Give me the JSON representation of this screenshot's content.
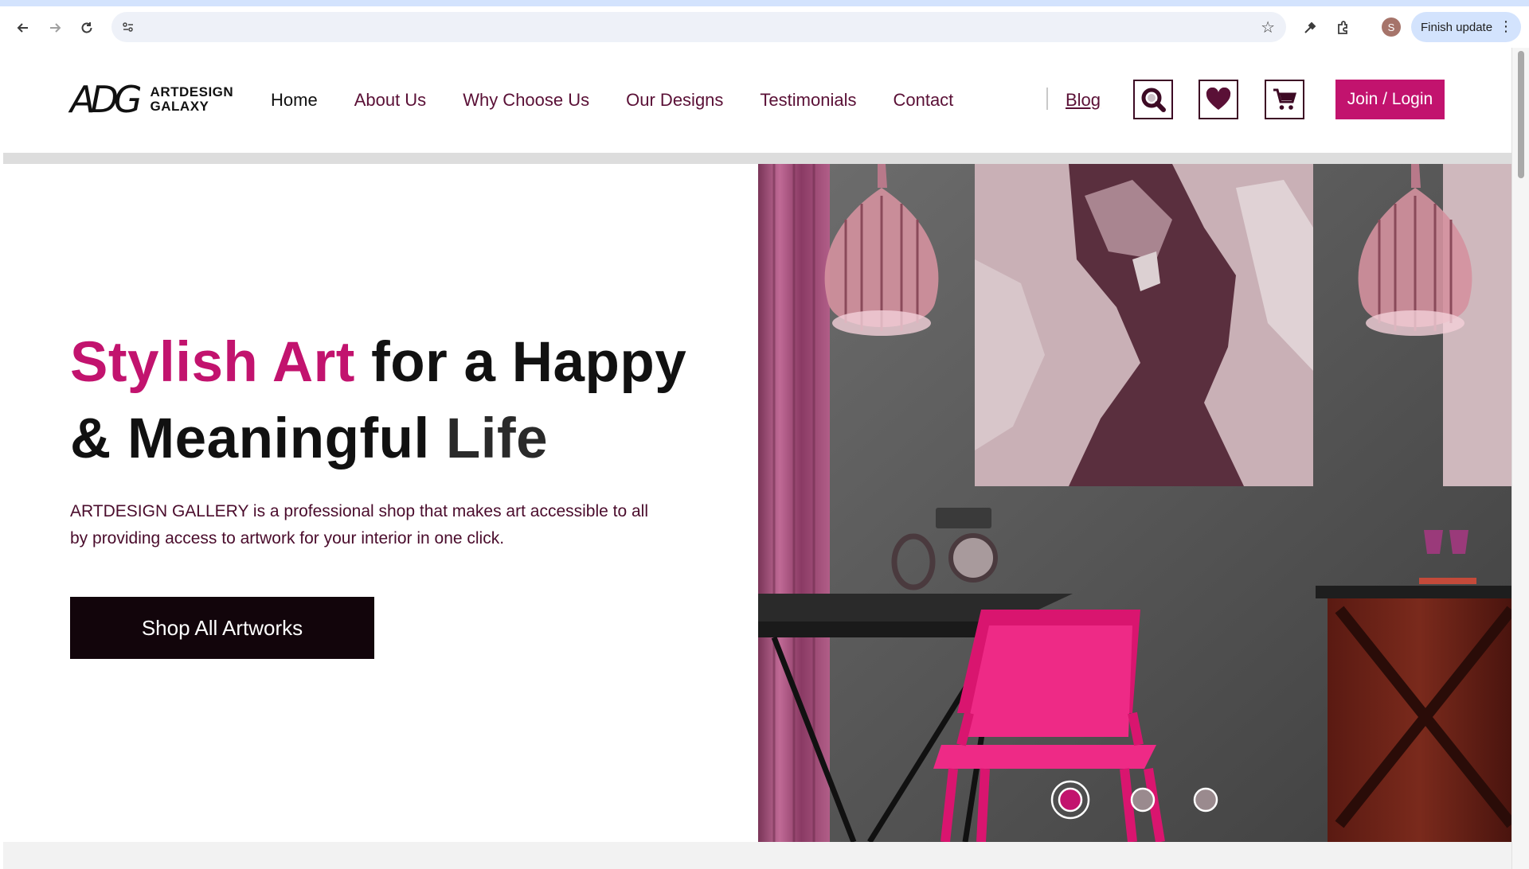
{
  "browser": {
    "finish_update_label": "Finish update",
    "avatar_initial": "S"
  },
  "site": {
    "logo_mark": "ADG",
    "logo_line1": "ARTDESIGN",
    "logo_line2": "GALAXY",
    "nav": [
      {
        "label": "Home"
      },
      {
        "label": "About Us"
      },
      {
        "label": "Why Choose Us"
      },
      {
        "label": "Our Designs"
      },
      {
        "label": "Testimonials"
      },
      {
        "label": "Contact"
      }
    ],
    "blog_label": "Blog",
    "join_label": "Join / Login"
  },
  "hero": {
    "title_accent": "Stylish Art",
    "title_rest1": " for a Happy",
    "title_line2": "& Meaningful ",
    "title_muted": "Life",
    "description": "ARTDESIGN GALLERY is a professional shop that makes art accessible to all by providing access to artwork for your interior in one click.",
    "cta_label": "Shop All Artworks",
    "carousel": {
      "total": 3,
      "active": 1
    }
  },
  "colors": {
    "accent": "#c2136e",
    "dark": "#12050b",
    "nav_text": "#5a1036",
    "chair_pink": "#e8197a"
  }
}
